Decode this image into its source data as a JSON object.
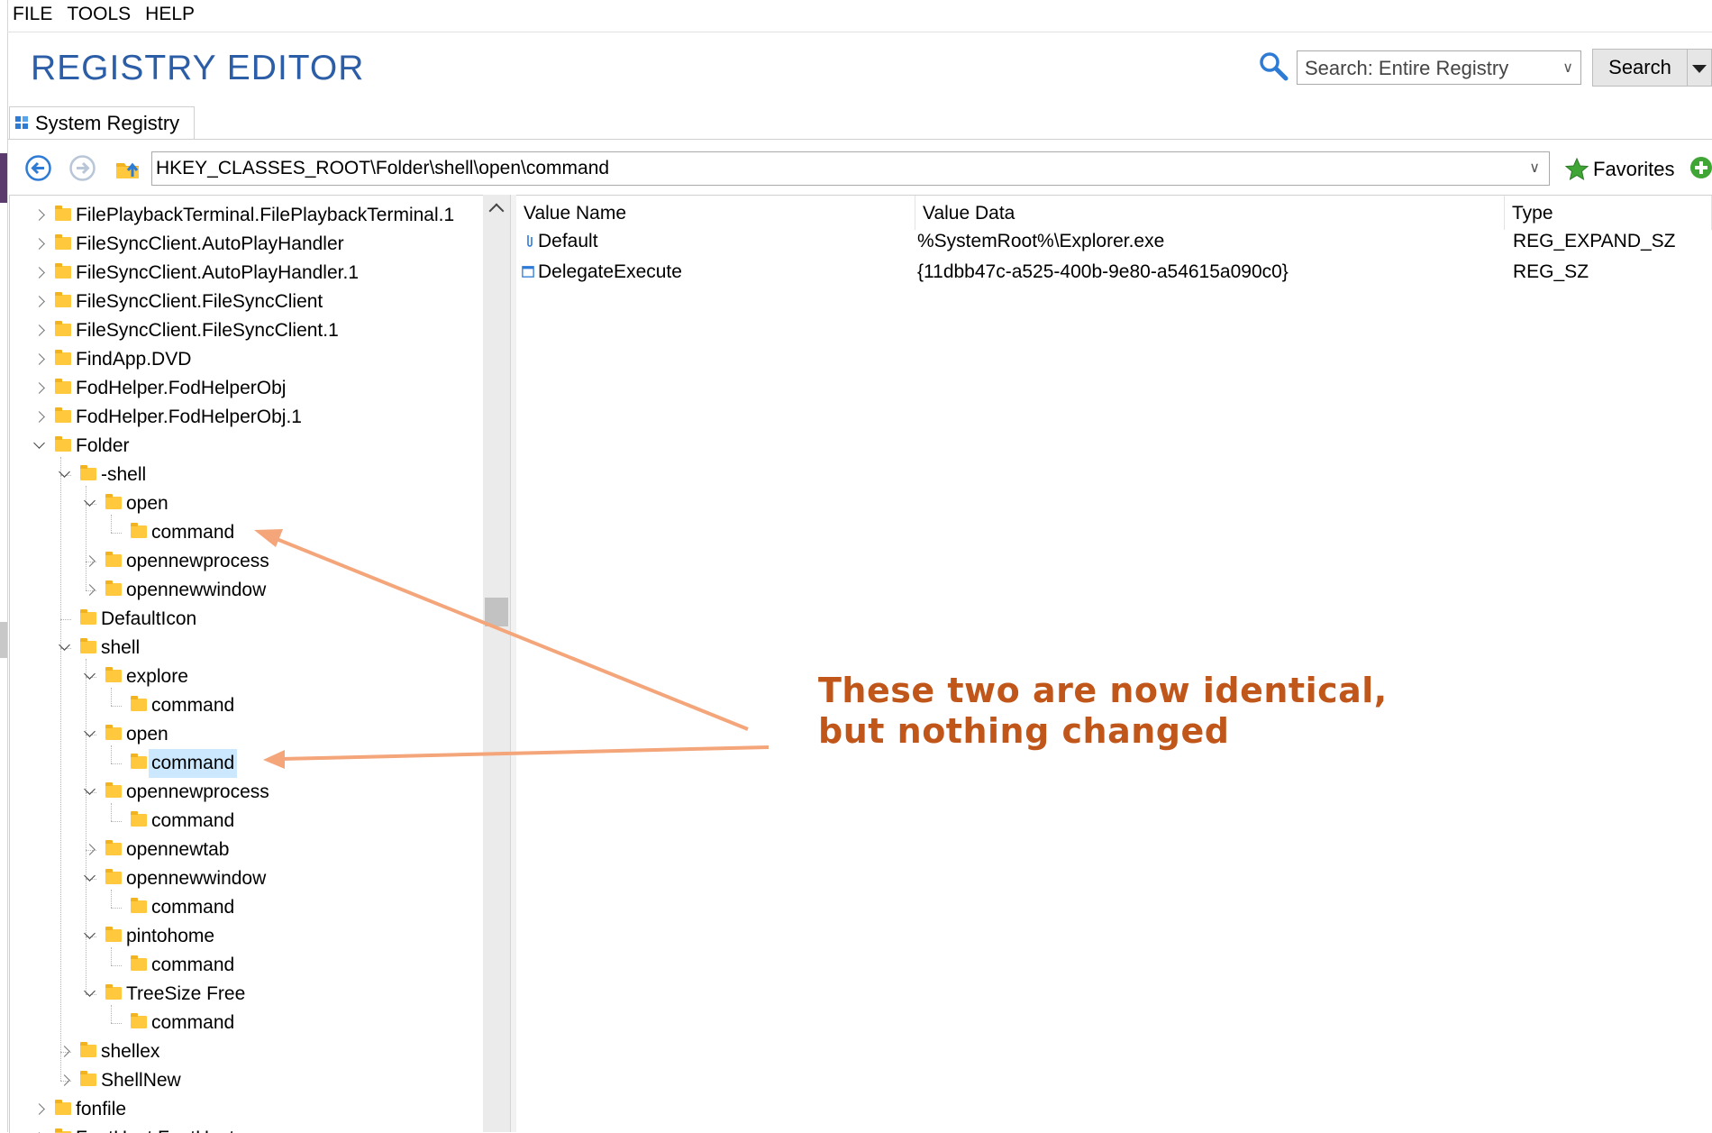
{
  "menu": [
    "FILE",
    "TOOLS",
    "HELP"
  ],
  "app_title": "REGISTRY EDITOR",
  "search": {
    "scope": "Search: Entire Registry",
    "button": "Search"
  },
  "tab": {
    "label": "System Registry"
  },
  "address": {
    "path": "HKEY_CLASSES_ROOT\\Folder\\shell\\open\\command"
  },
  "favorites_label": "Favorites",
  "tree": [
    {
      "label": "FilePlaybackTerminal.FilePlaybackTerminal.1",
      "depth": 0,
      "state": "collapsed"
    },
    {
      "label": "FileSyncClient.AutoPlayHandler",
      "depth": 0,
      "state": "collapsed"
    },
    {
      "label": "FileSyncClient.AutoPlayHandler.1",
      "depth": 0,
      "state": "collapsed"
    },
    {
      "label": "FileSyncClient.FileSyncClient",
      "depth": 0,
      "state": "collapsed"
    },
    {
      "label": "FileSyncClient.FileSyncClient.1",
      "depth": 0,
      "state": "collapsed"
    },
    {
      "label": "FindApp.DVD",
      "depth": 0,
      "state": "collapsed"
    },
    {
      "label": "FodHelper.FodHelperObj",
      "depth": 0,
      "state": "collapsed"
    },
    {
      "label": "FodHelper.FodHelperObj.1",
      "depth": 0,
      "state": "collapsed"
    },
    {
      "label": "Folder",
      "depth": 0,
      "state": "expanded"
    },
    {
      "label": "-shell",
      "depth": 1,
      "state": "expanded"
    },
    {
      "label": "open",
      "depth": 2,
      "state": "expanded"
    },
    {
      "label": "command",
      "depth": 3,
      "state": "leaf"
    },
    {
      "label": "opennewprocess",
      "depth": 2,
      "state": "collapsed"
    },
    {
      "label": "opennewwindow",
      "depth": 2,
      "state": "collapsed"
    },
    {
      "label": "DefaultIcon",
      "depth": 1,
      "state": "leaf"
    },
    {
      "label": "shell",
      "depth": 1,
      "state": "expanded"
    },
    {
      "label": "explore",
      "depth": 2,
      "state": "expanded"
    },
    {
      "label": "command",
      "depth": 3,
      "state": "leaf"
    },
    {
      "label": "open",
      "depth": 2,
      "state": "expanded"
    },
    {
      "label": "command",
      "depth": 3,
      "state": "leaf",
      "selected": true
    },
    {
      "label": "opennewprocess",
      "depth": 2,
      "state": "expanded"
    },
    {
      "label": "command",
      "depth": 3,
      "state": "leaf"
    },
    {
      "label": "opennewtab",
      "depth": 2,
      "state": "collapsed"
    },
    {
      "label": "opennewwindow",
      "depth": 2,
      "state": "expanded"
    },
    {
      "label": "command",
      "depth": 3,
      "state": "leaf"
    },
    {
      "label": "pintohome",
      "depth": 2,
      "state": "expanded"
    },
    {
      "label": "command",
      "depth": 3,
      "state": "leaf"
    },
    {
      "label": "TreeSize Free",
      "depth": 2,
      "state": "expanded"
    },
    {
      "label": "command",
      "depth": 3,
      "state": "leaf"
    },
    {
      "label": "shellex",
      "depth": 1,
      "state": "collapsed"
    },
    {
      "label": "ShellNew",
      "depth": 1,
      "state": "collapsed"
    },
    {
      "label": "fonfile",
      "depth": 0,
      "state": "collapsed"
    },
    {
      "label": "FontHost.FontHost",
      "depth": 0,
      "state": "collapsed"
    }
  ],
  "columns": [
    "Value Name",
    "Value Data",
    "Type"
  ],
  "values": [
    {
      "name": "Default",
      "data": "%SystemRoot%\\Explorer.exe",
      "type": "REG_EXPAND_SZ",
      "icon": "string-value-icon"
    },
    {
      "name": "DelegateExecute",
      "data": "{11dbb47c-a525-400b-9e80-a54615a090c0}",
      "type": "REG_SZ",
      "icon": "string-value-icon"
    }
  ],
  "annotation": {
    "line1": "These two are now identical,",
    "line2": "but nothing changed"
  },
  "colors": {
    "title": "#2c5ea7",
    "annotation": "#c0561a",
    "arrow": "#f4a57a",
    "folder": "#ffc83d",
    "selection": "#cce8ff"
  }
}
